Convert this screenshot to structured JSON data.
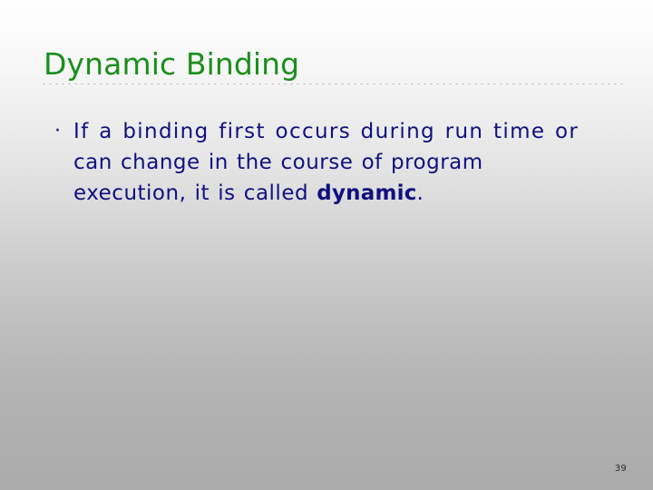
{
  "slide": {
    "title": "Dynamic Binding",
    "title_color": "#1a8f1a",
    "body_color": "#101080",
    "background_top_color": "#fefefe",
    "background_bottom_color": "#ababab",
    "divider_color": "#9a9a9a",
    "page_number": "39"
  },
  "body": {
    "bullets": [
      {
        "marker": "·",
        "lines": [
          "If a binding first occurs during run time or",
          "can change in the course of program",
          "execution, it is called "
        ],
        "emphasis": "dynamic",
        "trailing": "."
      }
    ]
  }
}
